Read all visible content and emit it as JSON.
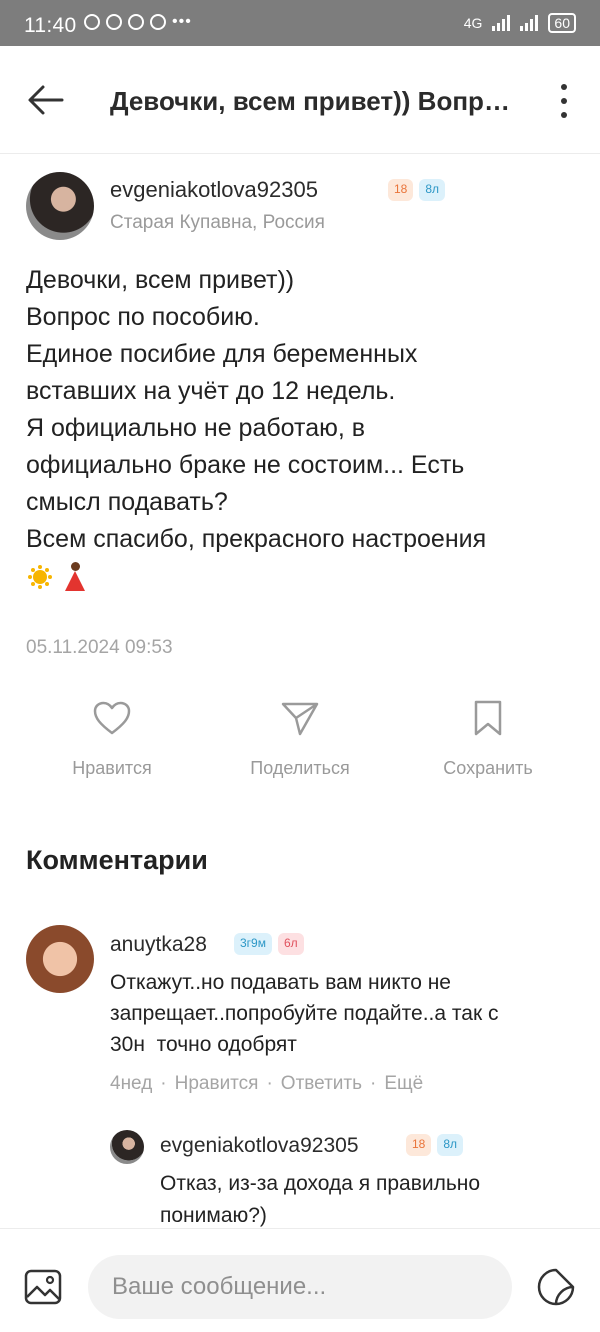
{
  "status_bar": {
    "time": "11:40",
    "network": "4G",
    "battery": "60"
  },
  "header": {
    "title": "Девочки, всем привет)) Вопрос по пособию."
  },
  "post": {
    "author": {
      "name": "evgeniakotlova92305",
      "badges": [
        "18",
        "8л"
      ],
      "location": "Старая Купавна, Россия"
    },
    "lines": [
      "Девочки, всем привет))",
      "Вопрос по пособию.",
      "Единое посибие для беременных",
      "вставших на учёт до 12 недель.",
      "Я официально не работаю, в",
      "официально браке не состоим... Есть",
      "смысл подавать?",
      "Всем спасибо, прекрасного настроения"
    ],
    "emojis": [
      "sun-emoji",
      "dancer-emoji"
    ],
    "date": "05.11.2024 09:53"
  },
  "actions": {
    "like": "Нравится",
    "share": "Поделиться",
    "save": "Сохранить"
  },
  "comments_title": "Комментарии",
  "comments": [
    {
      "name": "anuytka28",
      "badges": [
        "3г9м",
        "6л"
      ],
      "text": [
        "Откажут..но подавать вам никто не",
        "запрещает..попробуйте подайте..а так с",
        "30н  точно одобрят"
      ],
      "time": "4нед",
      "like": "Нравится",
      "reply": "Ответить",
      "more": "Ещё"
    }
  ],
  "reply": {
    "name": "evgeniakotlova92305",
    "badges": [
      "18",
      "8л"
    ],
    "text": [
      "Отказ, из-за дохода я правильно",
      "понимаю?)"
    ]
  },
  "composer": {
    "placeholder": "Ваше сообщение..."
  },
  "colors": {
    "badge_orange": "#e9743a",
    "badge_blue": "#2c97c6",
    "badge_pink": "#e0525e",
    "muted": "#9a9a9a"
  }
}
